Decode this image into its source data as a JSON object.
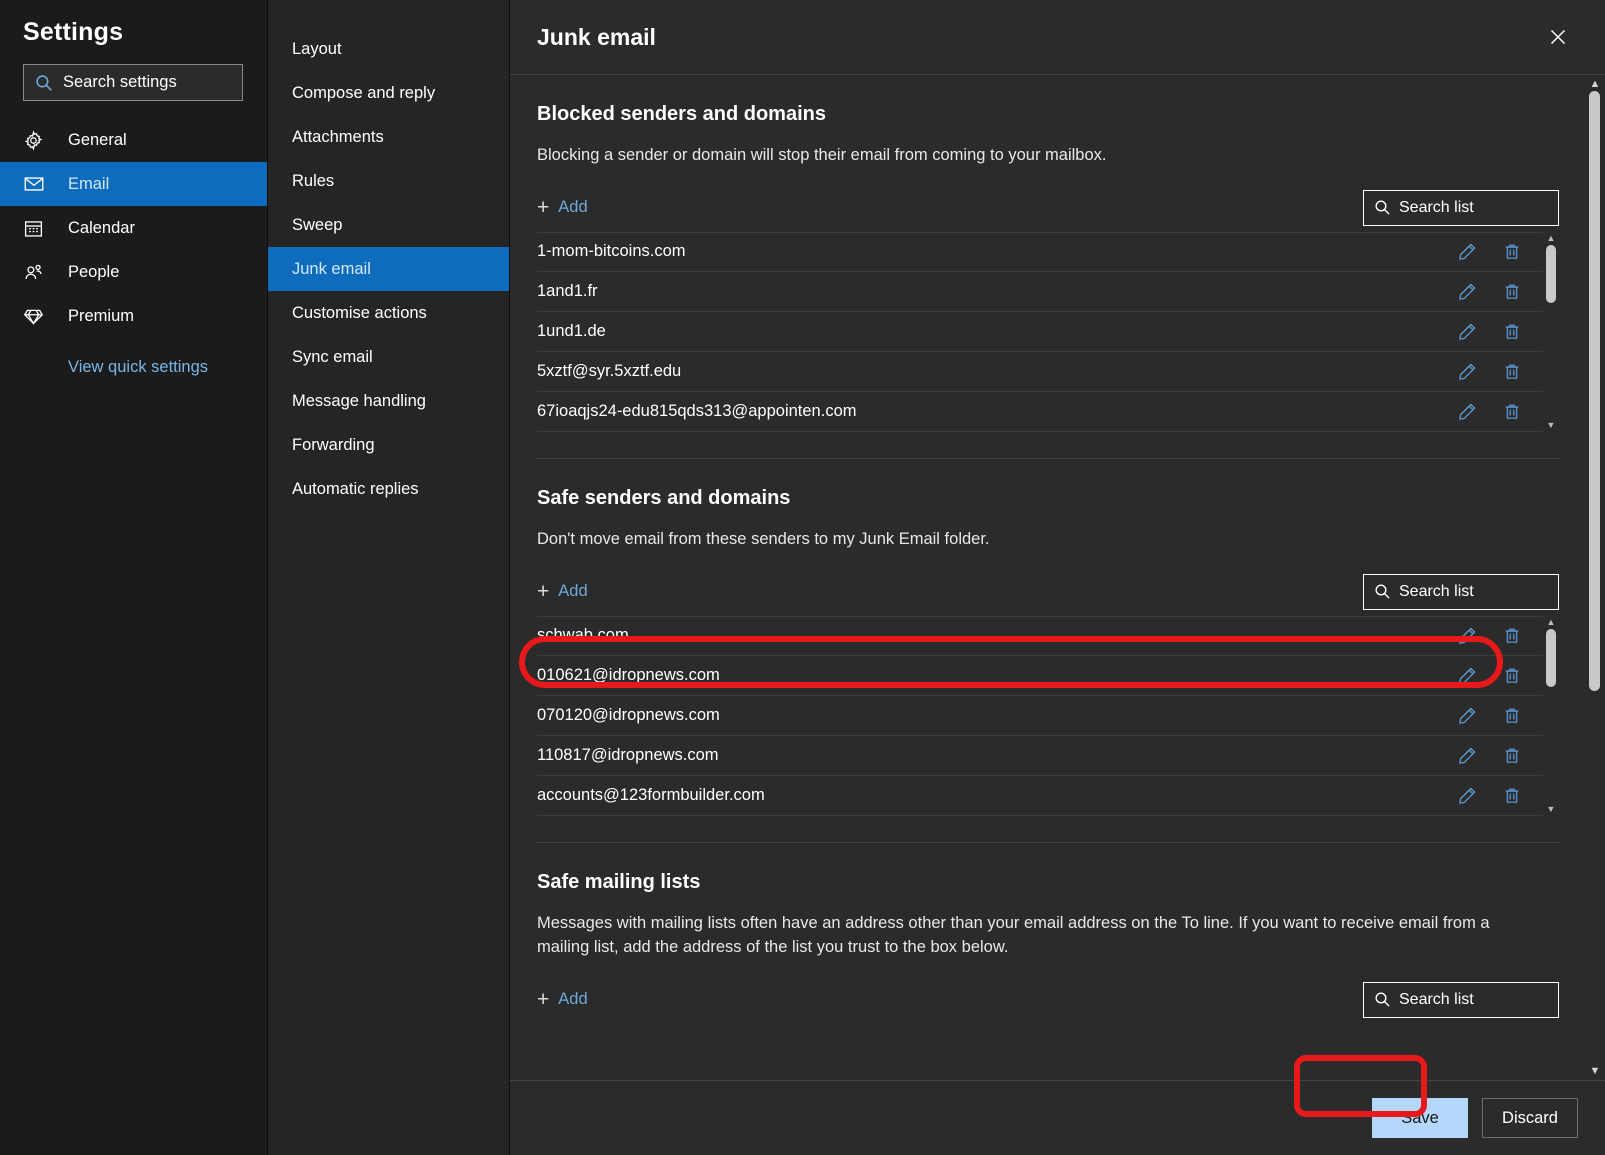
{
  "sidebar": {
    "title": "Settings",
    "search": {
      "placeholder": "Search settings",
      "value": "",
      "icon": "search-icon"
    },
    "items": [
      {
        "label": "General",
        "icon": "gear-icon",
        "active": false
      },
      {
        "label": "Email",
        "icon": "envelope-icon",
        "active": true
      },
      {
        "label": "Calendar",
        "icon": "calendar-icon",
        "active": false
      },
      {
        "label": "People",
        "icon": "people-icon",
        "active": false
      },
      {
        "label": "Premium",
        "icon": "diamond-icon",
        "active": false
      }
    ],
    "quick_settings_label": "View quick settings"
  },
  "subnav": {
    "items": [
      {
        "label": "Layout",
        "active": false
      },
      {
        "label": "Compose and reply",
        "active": false
      },
      {
        "label": "Attachments",
        "active": false
      },
      {
        "label": "Rules",
        "active": false
      },
      {
        "label": "Sweep",
        "active": false
      },
      {
        "label": "Junk email",
        "active": true
      },
      {
        "label": "Customise actions",
        "active": false
      },
      {
        "label": "Sync email",
        "active": false
      },
      {
        "label": "Message handling",
        "active": false
      },
      {
        "label": "Forwarding",
        "active": false
      },
      {
        "label": "Automatic replies",
        "active": false
      }
    ]
  },
  "header": {
    "title": "Junk email",
    "close_icon": "close-icon"
  },
  "sections": {
    "blocked": {
      "title": "Blocked senders and domains",
      "description": "Blocking a sender or domain will stop their email from coming to your mailbox.",
      "add_label": "Add",
      "search_placeholder": "Search list",
      "search_value": "",
      "items": [
        "1-mom-bitcoins.com",
        "1and1.fr",
        "1und1.de",
        "5xztf@syr.5xztf.edu",
        "67ioaqjs24-edu815qds313@appointen.com"
      ]
    },
    "safe_senders": {
      "title": "Safe senders and domains",
      "description": "Don't move email from these senders to my Junk Email folder.",
      "add_label": "Add",
      "search_placeholder": "Search list",
      "search_value": "",
      "items": [
        "schwab.com",
        "010621@idropnews.com",
        "070120@idropnews.com",
        "110817@idropnews.com",
        "accounts@123formbuilder.com"
      ],
      "highlighted_item": "schwab.com"
    },
    "safe_mailing_lists": {
      "title": "Safe mailing lists",
      "description": "Messages with mailing lists often have an address other than your email address on the To line. If you want to receive email from a mailing list, add the address of the list you trust to the box below.",
      "add_label": "Add",
      "search_placeholder": "Search list",
      "search_value": ""
    }
  },
  "row_actions": {
    "edit_icon": "pencil-edit-icon",
    "delete_icon": "trash-delete-icon"
  },
  "footer": {
    "save_label": "Save",
    "discard_label": "Discard"
  },
  "colors": {
    "accent_blue": "#0f6cbd",
    "link_blue": "#6fa8dc",
    "icon_blue": "#5b9bd5",
    "annotation_red": "#e8191b",
    "save_button_bg": "#b3d8fb",
    "sidebar_bg": "#1b1b1b",
    "subnav_bg": "#252525",
    "main_bg": "#2b2b2b"
  }
}
